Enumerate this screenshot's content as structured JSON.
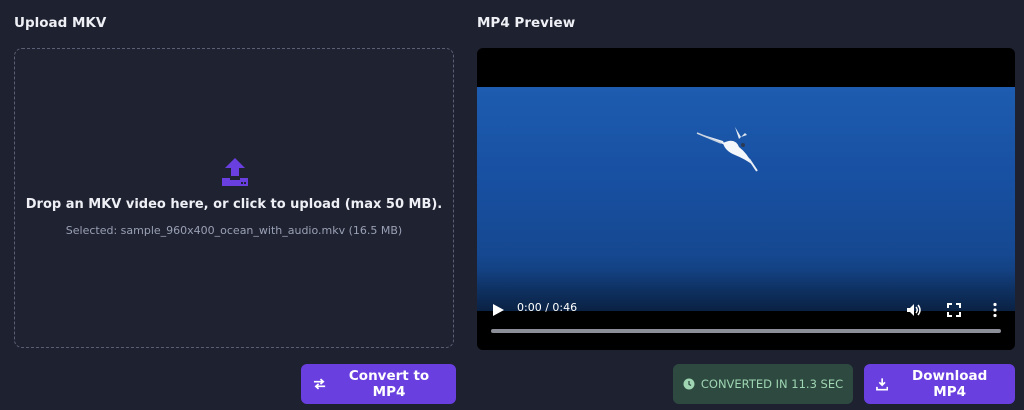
{
  "upload": {
    "title": "Upload MKV",
    "prompt": "Drop an MKV video here, or click to upload (max 50 MB).",
    "selected": "Selected: sample_960x400_ocean_with_audio.mkv (16.5 MB)",
    "icon": "upload-icon"
  },
  "preview": {
    "title": "MP4 Preview",
    "time": "0:00 / 0:46",
    "progress": 0
  },
  "actions": {
    "convert_label": "Convert to MP4",
    "status_label": "CONVERTED IN 11.3 SEC",
    "download_label": "Download MP4"
  },
  "colors": {
    "background": "#1e2130",
    "accent": "#6a3fe0",
    "success_bg": "#2e4a40",
    "success_text": "#9fd5b2"
  }
}
